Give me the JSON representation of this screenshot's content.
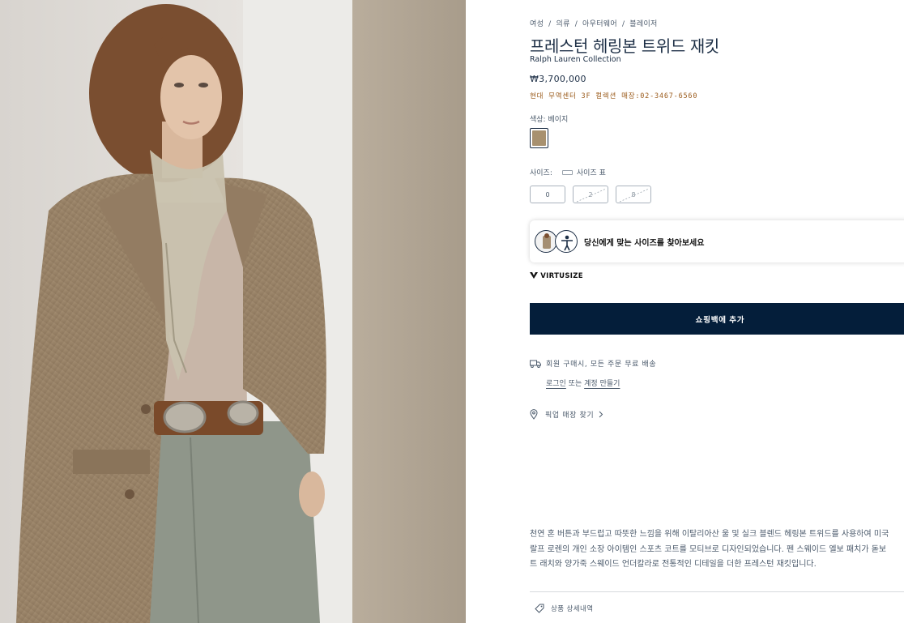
{
  "breadcrumb": [
    "여성",
    "의류",
    "아우터웨어",
    "블레이저"
  ],
  "product": {
    "title": "프레스턴 헤링본 트위드 재킷",
    "brand": "Ralph Lauren Collection",
    "price": "₩3,700,000",
    "store_info": "현대 무역센터 3F 컬렉션 매장:02-3467-6560"
  },
  "color": {
    "label": "색상: 베이지",
    "swatch_hex": "#a8916f"
  },
  "size": {
    "label": "사이즈:",
    "chart_link": "사이즈 표",
    "options": [
      "0",
      "2",
      "8"
    ]
  },
  "virtusize": {
    "prompt": "당신에게 맞는 사이즈를 찾아보세요",
    "logo": "VIRTUSIZE"
  },
  "add_to_bag": "쇼핑백에 추가",
  "shipping": {
    "text": "회원 구매시, 모든 주문 무료 배송",
    "login": "로그인",
    "or": "또는",
    "create_account": "계정 만들기"
  },
  "pickup": {
    "label": "픽업 매장 찾기"
  },
  "description": [
    "천연 혼 버튼과 부드럽고 따뜻한 느낌을 위해 이탈리아산 울 및 실크 블렌드 헤링본 트위드를 사용하여 미국",
    "랄프 로렌의 개인 소장 아이템인 스포츠 코트를 모티브로 디자인되었습니다. 펜 스웨이드 엘보 패치가 돋보",
    "트 래치와 양가죽 스웨이드 언더칼라로 전통적인 디테일을 더한 프레스턴 재킷입니다."
  ],
  "details_label": "상품 상세내역",
  "colors": {
    "navy": "#041e3a",
    "store_text": "#9a5a1a"
  }
}
